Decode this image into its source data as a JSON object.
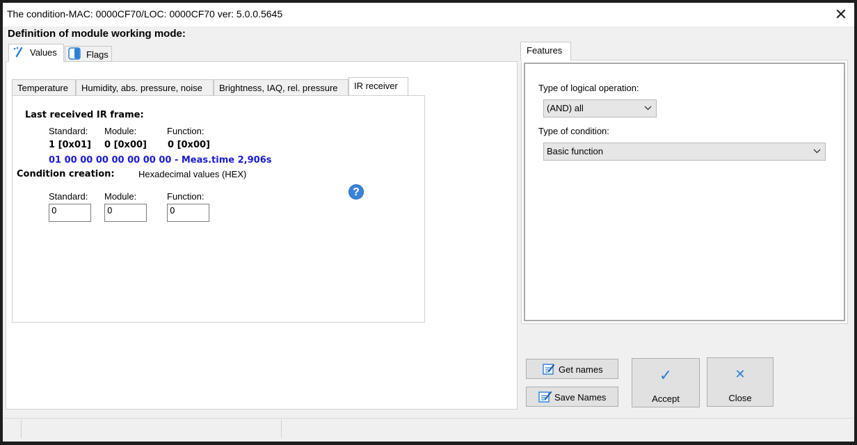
{
  "window": {
    "title": "The condition-MAC: 0000CF70/LOC: 0000CF70 ver: 5.0.0.5645",
    "close_glyph": "✕"
  },
  "heading": "Definition of module working mode:",
  "main_tabs": [
    {
      "label": "Values",
      "icon": "values-icon",
      "active": true
    },
    {
      "label": "Flags",
      "icon": "flags-icon",
      "active": false
    }
  ],
  "sub_tabs": [
    {
      "label": "Temperature",
      "active": false
    },
    {
      "label": "Humidity, abs. pressure, noise",
      "active": false
    },
    {
      "label": "Brightness, IAQ, rel. pressure",
      "active": false
    },
    {
      "label": "IR receiver",
      "active": true
    }
  ],
  "ir": {
    "last_frame_title": "Last received IR frame:",
    "col_standard": "Standard:",
    "col_module": "Module:",
    "col_function": "Function:",
    "val_standard": "1 [0x01]",
    "val_module": "0 [0x00]",
    "val_function": "0 [0x00]",
    "frame_line": "01 00 00 00 00 00 00 00 - Meas.time 2,906s",
    "condition_creation": "Condition creation:",
    "hex_note": "Hexadecimal values (HEX)",
    "input_standard_label": "Standard:",
    "input_module_label": "Module:",
    "input_function_label": "Function:",
    "input_standard_value": "0",
    "input_module_value": "0",
    "input_function_value": "0",
    "help_glyph": "?"
  },
  "features": {
    "tab_label": "Features",
    "logical_op_label": "Type of logical operation:",
    "logical_op_value": "(AND) all",
    "condition_type_label": "Type of condition:",
    "condition_type_value": "Basic function"
  },
  "buttons": {
    "get_names": "Get names",
    "save_names": "Save Names",
    "accept": "Accept",
    "close": "Close",
    "accept_glyph": "✓",
    "close_glyph": "✕"
  },
  "colors": {
    "blue_text": "#1a1ad4",
    "accent": "#3a84d8"
  }
}
